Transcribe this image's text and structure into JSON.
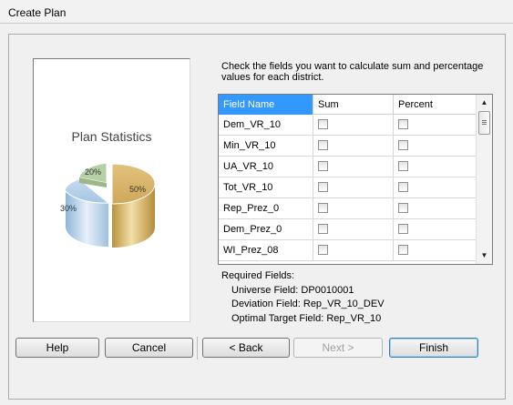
{
  "window": {
    "title": "Create Plan"
  },
  "side_panel": {
    "title": "Plan Statistics",
    "pie_labels": [
      "20%",
      "30%",
      "50%"
    ],
    "colors": {
      "gold": "#d3b266",
      "blue": "#a6c6e3",
      "green": "#b7cfa6"
    }
  },
  "instructions": "Check the fields you want to calculate sum and percentage values for each district.",
  "grid": {
    "headers": {
      "name": "Field Name",
      "sum": "Sum",
      "percent": "Percent"
    },
    "rows": [
      {
        "name": "Dem_VR_10",
        "sum": false,
        "percent": false
      },
      {
        "name": "Min_VR_10",
        "sum": false,
        "percent": false
      },
      {
        "name": "UA_VR_10",
        "sum": false,
        "percent": false
      },
      {
        "name": "Tot_VR_10",
        "sum": false,
        "percent": false
      },
      {
        "name": "Rep_Prez_0",
        "sum": false,
        "percent": false
      },
      {
        "name": "Dem_Prez_0",
        "sum": false,
        "percent": false
      },
      {
        "name": "WI_Prez_08",
        "sum": false,
        "percent": false
      }
    ]
  },
  "required": {
    "heading": "Required Fields:",
    "universe": "Universe Field: DP0010001",
    "deviation": "Deviation Field: Rep_VR_10_DEV",
    "optimal": "Optimal Target Field: Rep_VR_10"
  },
  "buttons": {
    "help": "Help",
    "cancel": "Cancel",
    "back": "< Back",
    "next": "Next >",
    "finish": "Finish"
  }
}
